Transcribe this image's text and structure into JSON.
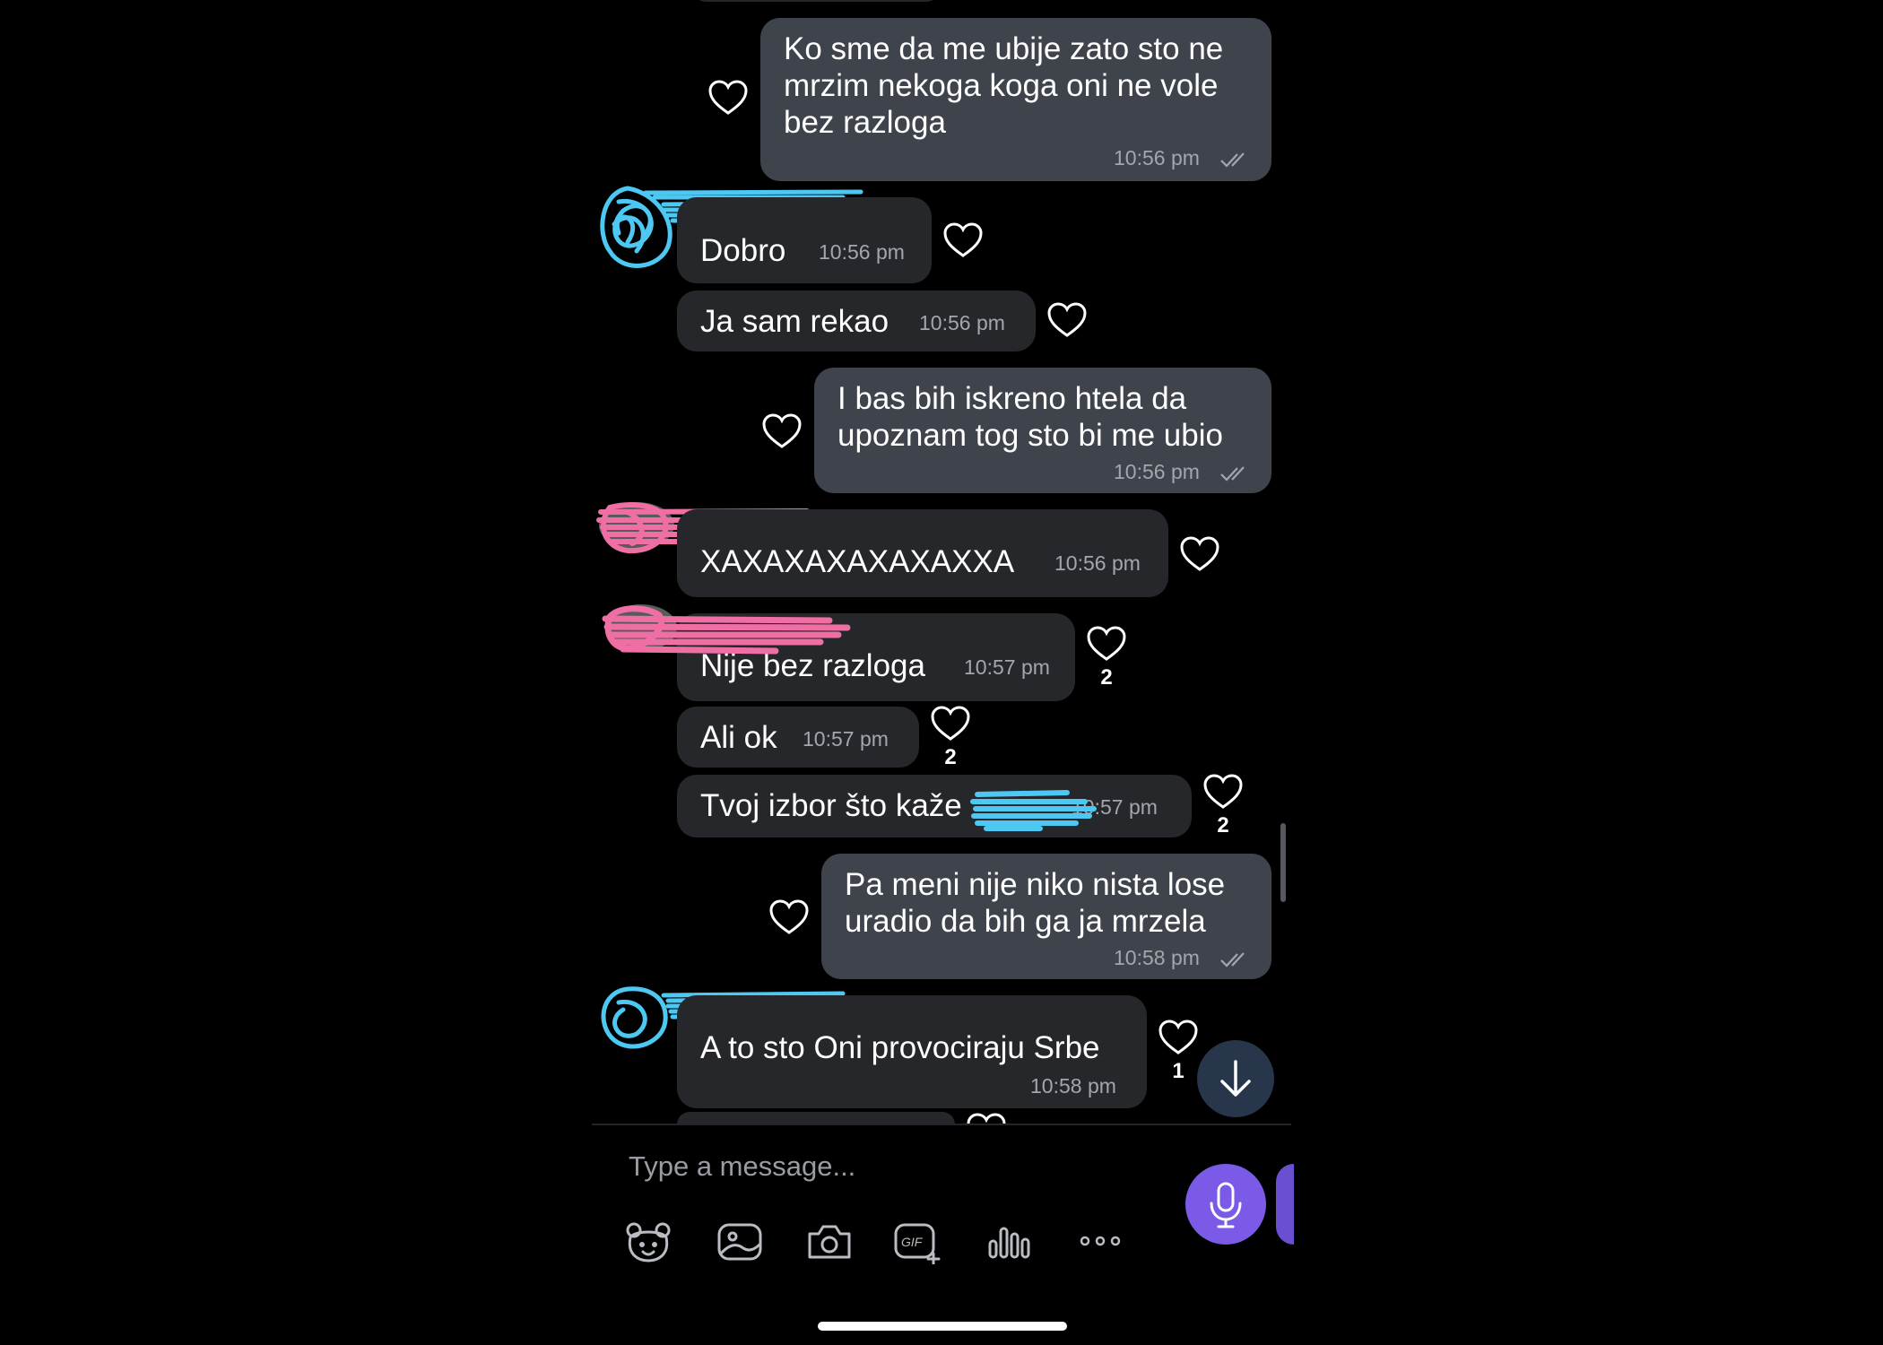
{
  "input": {
    "placeholder": "Type a message..."
  },
  "toolbar_icons": [
    "sticker-icon",
    "gallery-icon",
    "camera-icon",
    "gif-icon",
    "audio-icon",
    "more-icon"
  ],
  "accent_color": "#7a5ae6",
  "messages": [
    {
      "direction": "outgoing",
      "lines": [
        "Ko sme da me ubije zato sto ne",
        "mrzim nekoga koga oni ne vole",
        "bez razloga"
      ],
      "time": "10:56 pm",
      "read": true
    },
    {
      "direction": "incoming",
      "lines": [
        "Dobro"
      ],
      "time": "10:56 pm"
    },
    {
      "direction": "incoming",
      "lines": [
        "Ja sam rekao"
      ],
      "time": "10:56 pm"
    },
    {
      "direction": "outgoing",
      "lines": [
        "I bas bih iskreno htela da",
        "upoznam tog sto bi me ubio"
      ],
      "time": "10:56 pm",
      "read": true
    },
    {
      "direction": "incoming",
      "lines": [
        "XAXAXAXAXAXAXXA"
      ],
      "time": "10:56 pm"
    },
    {
      "direction": "incoming",
      "lines": [
        "Nije bez razloga"
      ],
      "time": "10:57 pm",
      "likes": "2"
    },
    {
      "direction": "incoming",
      "lines": [
        "Ali ok"
      ],
      "time": "10:57 pm",
      "likes": "2"
    },
    {
      "direction": "incoming",
      "lines": [
        "Tvoj izbor što kaže"
      ],
      "time": "10:57 pm",
      "likes": "2"
    },
    {
      "direction": "outgoing",
      "lines": [
        "Pa meni nije niko nista lose",
        "uradio da bih ga ja mrzela"
      ],
      "time": "10:58 pm",
      "read": true
    },
    {
      "direction": "incoming",
      "lines": [
        "A to sto Oni provociraju Srbe"
      ],
      "time": "10:58 pm",
      "likes": "1"
    }
  ]
}
